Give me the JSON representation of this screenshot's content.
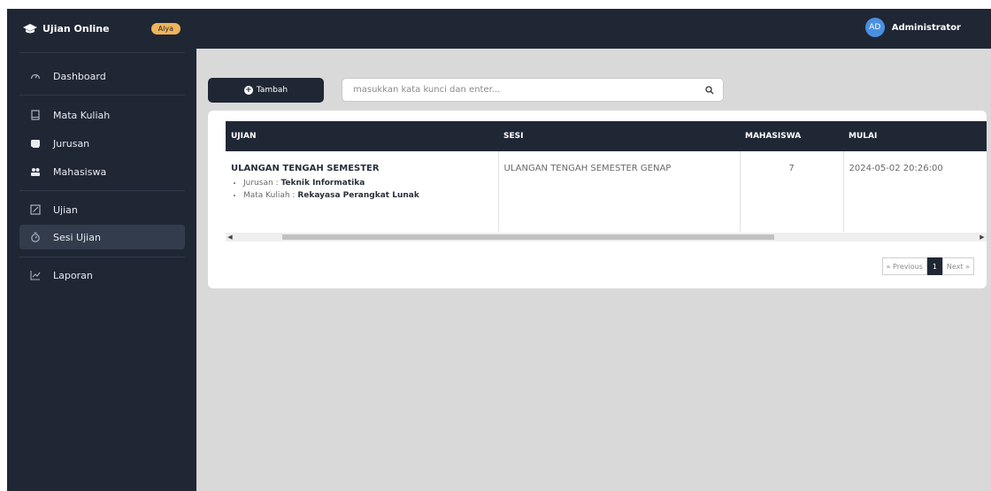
{
  "brand": {
    "title": "Ujian Online",
    "badge": "Alya"
  },
  "user": {
    "initials": "AD",
    "name": "Administrator"
  },
  "sidebar": {
    "items": [
      {
        "label": "Dashboard",
        "icon": "dashboard-gauge-icon",
        "active": false
      },
      {
        "label": "Mata Kuliah",
        "icon": "book-icon",
        "active": false
      },
      {
        "label": "Jurusan",
        "icon": "folder-icon",
        "active": false
      },
      {
        "label": "Mahasiswa",
        "icon": "users-icon",
        "active": false
      },
      {
        "label": "Ujian",
        "icon": "edit-icon",
        "active": false
      },
      {
        "label": "Sesi Ujian",
        "icon": "timer-icon",
        "active": true
      },
      {
        "label": "Laporan",
        "icon": "chart-line-icon",
        "active": false
      }
    ]
  },
  "toolbar": {
    "add_label": "Tambah",
    "search_placeholder": "masukkan kata kunci dan enter..."
  },
  "table": {
    "headers": [
      "UJIAN",
      "SESI",
      "MAHASISWA",
      "MULAI"
    ],
    "rows": [
      {
        "ujian_title": "ULANGAN TENGAH SEMESTER",
        "jurusan_label": "Jurusan : ",
        "jurusan_value": "Teknik Informatika",
        "matkul_label": "Mata Kuliah : ",
        "matkul_value": "Rekayasa Perangkat Lunak",
        "sesi": "ULANGAN TENGAH SEMESTER GENAP",
        "mahasiswa": "7",
        "mulai": "2024-05-02 20:26:00"
      }
    ]
  },
  "pagination": {
    "previous": "« Previous",
    "current": "1",
    "next": "Next »"
  },
  "colors": {
    "dark": "#1f2735",
    "content_bg": "#d9d9d9",
    "badge": "#f0b35a",
    "avatar": "#4a90e2"
  }
}
